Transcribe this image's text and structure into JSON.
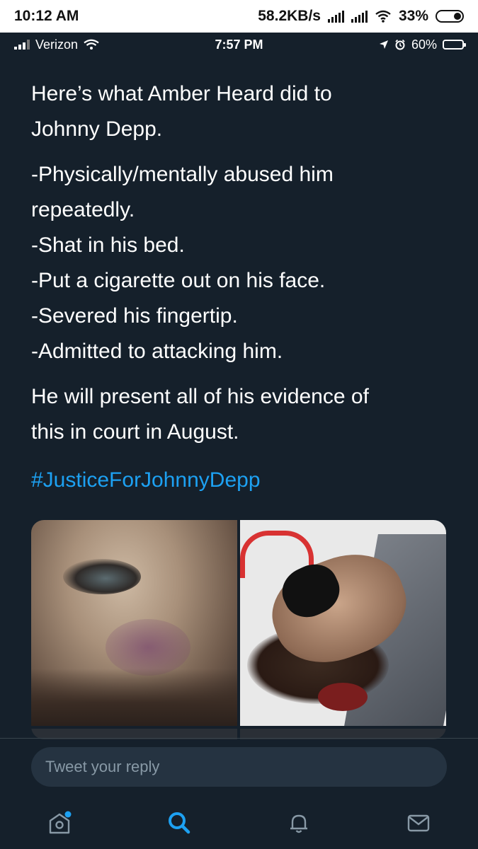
{
  "outer_status": {
    "time": "10:12 AM",
    "speed": "58.2KB/s",
    "battery": "33%"
  },
  "inner_status": {
    "carrier": "Verizon",
    "time": "7:57 PM",
    "battery": "60%",
    "battery_level": 0.6
  },
  "tweet": {
    "paragraph_1": [
      "Here’s what Amber Heard did to",
      "Johnny Depp."
    ],
    "list": [
      "-Physically/mentally abused him",
      "repeatedly.",
      "-Shat in his bed.",
      "-Put a cigarette out on his face.",
      "-Severed his fingertip.",
      "-Admitted to attacking him."
    ],
    "paragraph_2": [
      "He will present all of his evidence of",
      "this in court in August."
    ],
    "hashtag": "#JusticeForJohnnyDepp"
  },
  "reply": {
    "placeholder": "Tweet your reply"
  },
  "tabbar": {
    "icons": [
      "home-icon",
      "search-icon",
      "notifications-icon",
      "messages-icon"
    ]
  },
  "colors": {
    "background": "#15202b",
    "accent": "#1da1f2",
    "muted": "#8899a6",
    "reply_field": "#253341"
  }
}
